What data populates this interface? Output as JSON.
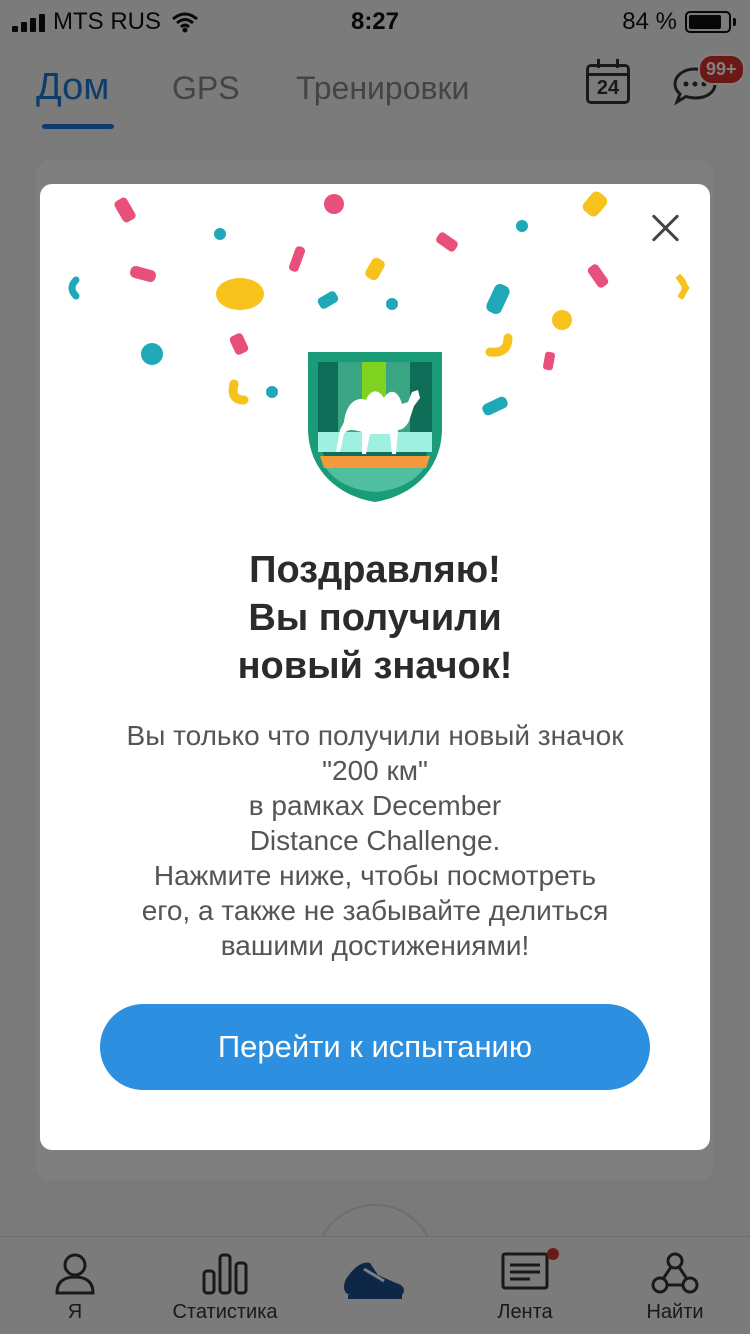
{
  "status_bar": {
    "carrier": "MTS RUS",
    "time": "8:27",
    "battery_percent": "84 %",
    "battery_level": 0.84
  },
  "top_nav": {
    "tabs": [
      {
        "label": "Дом",
        "active": true
      },
      {
        "label": "GPS",
        "active": false
      },
      {
        "label": "Тренировки",
        "active": false
      }
    ],
    "calendar_day": "24",
    "messages_badge": "99+"
  },
  "bottom_bar": {
    "items": [
      {
        "label": "Я",
        "icon": "person-icon"
      },
      {
        "label": "Статистика",
        "icon": "bar-chart-icon"
      },
      {
        "label": "",
        "icon": "running-shoe-icon"
      },
      {
        "label": "Лента",
        "icon": "feed-icon"
      },
      {
        "label": "Найти",
        "icon": "network-icon"
      }
    ]
  },
  "modal": {
    "title_lines": [
      "Поздравляю!",
      "Вы получили",
      "новый значок!"
    ],
    "body_lines": [
      "Вы только что получили новый значок",
      "\"200 км\"",
      "в рамках December",
      "Distance Challenge.",
      " Нажмите ниже, чтобы посмотреть",
      "его, а также не забывайте делиться",
      "вашими достижениями!"
    ],
    "button_label": "Перейти к испытанию",
    "badge_icon": "camel-badge-icon",
    "colors": {
      "accent": "#2c8fe0",
      "badge_green": "#1a9c79",
      "badge_orange": "#f59a3c",
      "confetti": [
        "#e94f7b",
        "#f7c21c",
        "#1fa9b8"
      ]
    }
  }
}
